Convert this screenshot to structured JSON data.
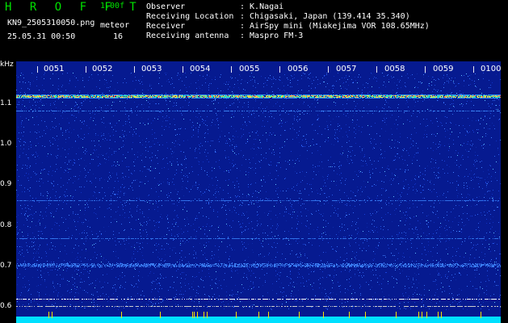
{
  "header": {
    "title": "H R O F F T",
    "version": "1.00f",
    "filename": "KN9_2505310050.png",
    "datetime": "25.05.31 00:50",
    "meteor_label": "meteor",
    "meteor_count": "16",
    "fields": [
      {
        "label": "Observer",
        "value": ": K.Nagai"
      },
      {
        "label": "Receiving Location",
        "value": ": Chigasaki, Japan (139.414 35.340)"
      },
      {
        "label": "Receiver",
        "value": ": AirSpy mini (Miakejima VOR 108.65MHz)"
      },
      {
        "label": "Receiving antenna",
        "value": ": Maspro FM-3"
      }
    ]
  },
  "axis": {
    "unit": "kHz",
    "y_ticks": [
      "1.1",
      "1.0",
      "0.9",
      "0.8",
      "0.7",
      "0.6"
    ],
    "time_ticks": [
      "0051",
      "0052",
      "0053",
      "0054",
      "0055",
      "0056",
      "0057",
      "0058",
      "0059",
      "0100"
    ]
  },
  "colors": {
    "background": "#061a90",
    "carrier": "#30e0c0",
    "baseline": "#00e0ff",
    "header_green": "#00e000"
  }
}
